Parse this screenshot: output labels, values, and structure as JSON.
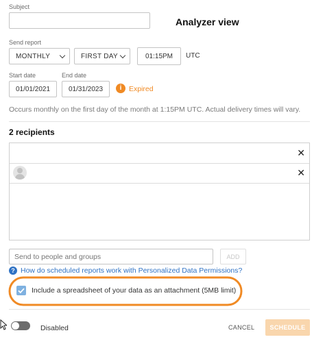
{
  "annotation": "Analyzer view",
  "subject": {
    "label": "Subject",
    "value": ""
  },
  "send_report": {
    "label": "Send report",
    "frequency": "MONTHLY",
    "day": "FIRST DAY",
    "time": "01:15PM",
    "timezone": "UTC"
  },
  "start_date": {
    "label": "Start date",
    "value": "01/01/2021"
  },
  "end_date": {
    "label": "End date",
    "value": "01/31/2023"
  },
  "expired_label": "Expired",
  "schedule_summary": "Occurs monthly on the first day of the month at 1:15PM UTC. Actual delivery times will vary.",
  "recipients": {
    "heading": "2 recipients",
    "rows": [
      {
        "name": "",
        "has_avatar": false
      },
      {
        "name": "",
        "has_avatar": true
      }
    ],
    "input_placeholder": "Send to people and groups",
    "add_label": "ADD"
  },
  "help_link": "How do scheduled reports work with Personalized Data Permissions?",
  "attachment_checkbox": {
    "label": "Include a spreadsheet of your data as an attachment (5MB limit)",
    "checked": true
  },
  "toggle": {
    "label": "Disabled",
    "enabled": false
  },
  "cancel_label": "CANCEL",
  "schedule_label": "SCHEDULE",
  "colors": {
    "accent_orange": "#f08a24",
    "link_blue": "#2f72c4",
    "checkbox_blue": "#7fb1e0",
    "schedule_disabled": "#f9d6ad"
  }
}
